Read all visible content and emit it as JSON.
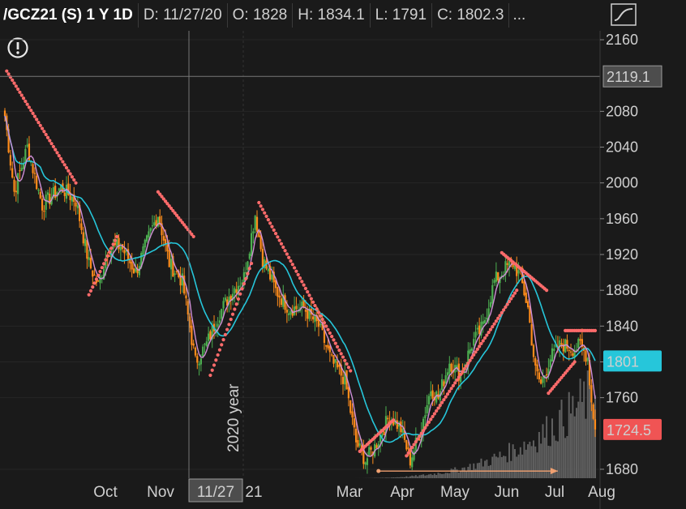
{
  "header": {
    "symbol": "/GCZ21 (S) 1 Y 1D",
    "date": "D: 11/27/20",
    "open": "O: 1828",
    "high": "H: 1834.1",
    "low": "L: 1791",
    "close": "C: 1802.3",
    "more": "..."
  },
  "icons": {
    "style": "chart-style-icon",
    "alert": "exclamation-circle-icon"
  },
  "colors": {
    "background": "#1a1a1a",
    "up": "#4caf50",
    "down": "#ff8c1a",
    "ma_fast": "#d08fd6",
    "ma_slow": "#26c6da",
    "sar": "#ff6b6b",
    "volume": "#606060",
    "crosshair_label": "#4d4d4d"
  },
  "chart_data": {
    "type": "candlestick",
    "y_ticks": [
      "2160",
      "2080",
      "2040",
      "2000",
      "1960",
      "1920",
      "1880",
      "1840",
      "1800",
      "1760",
      "1680"
    ],
    "ylim": [
      1670,
      2170
    ],
    "x_labels": [
      "Oct",
      "Nov",
      "11/27",
      "21",
      "Mar",
      "Apr",
      "May",
      "Jun",
      "Jul",
      "Aug"
    ],
    "crosshair": {
      "x_label": "11/27",
      "y_label": "2119.1",
      "price": 2119.1
    },
    "price_labels": [
      {
        "name": "sma",
        "text": "1801",
        "value": 1801,
        "color": "#26c6da"
      },
      {
        "name": "last",
        "text": "1724.5",
        "value": 1724.5,
        "color": "#f05454"
      }
    ],
    "year_label": "2020 year",
    "price_path_anchors": [
      [
        0,
        2075
      ],
      [
        5,
        1990
      ],
      [
        12,
        2040
      ],
      [
        20,
        1975
      ],
      [
        30,
        1995
      ],
      [
        38,
        1980
      ],
      [
        45,
        1910
      ],
      [
        50,
        1885
      ],
      [
        55,
        1925
      ],
      [
        62,
        1930
      ],
      [
        70,
        1900
      ],
      [
        78,
        1945
      ],
      [
        82,
        1965
      ],
      [
        88,
        1910
      ],
      [
        95,
        1890
      ],
      [
        102,
        1800
      ],
      [
        108,
        1820
      ],
      [
        115,
        1855
      ],
      [
        122,
        1880
      ],
      [
        128,
        1895
      ],
      [
        134,
        1965
      ],
      [
        138,
        1915
      ],
      [
        145,
        1880
      ],
      [
        152,
        1860
      ],
      [
        160,
        1860
      ],
      [
        168,
        1840
      ],
      [
        175,
        1800
      ],
      [
        182,
        1780
      ],
      [
        188,
        1710
      ],
      [
        193,
        1690
      ],
      [
        198,
        1705
      ],
      [
        206,
        1740
      ],
      [
        212,
        1725
      ],
      [
        217,
        1690
      ],
      [
        222,
        1720
      ],
      [
        228,
        1770
      ],
      [
        232,
        1760
      ],
      [
        238,
        1800
      ],
      [
        244,
        1785
      ],
      [
        250,
        1820
      ],
      [
        256,
        1840
      ],
      [
        262,
        1890
      ],
      [
        268,
        1905
      ],
      [
        272,
        1910
      ],
      [
        276,
        1895
      ],
      [
        280,
        1860
      ],
      [
        284,
        1790
      ],
      [
        287,
        1775
      ],
      [
        292,
        1805
      ],
      [
        298,
        1820
      ],
      [
        304,
        1815
      ],
      [
        308,
        1818
      ],
      [
        312,
        1805
      ],
      [
        314,
        1755
      ],
      [
        316,
        1724.5
      ]
    ],
    "sar_segments": [
      {
        "from": [
          1,
          2125
        ],
        "to": [
          38,
          2000
        ]
      },
      {
        "from": [
          45,
          1875
        ],
        "to": [
          60,
          1940
        ]
      },
      {
        "from": [
          82,
          1990
        ],
        "to": [
          101,
          1940
        ]
      },
      {
        "from": [
          110,
          1785
        ],
        "to": [
          132,
          1910
        ]
      },
      {
        "from": [
          136,
          1978
        ],
        "to": [
          185,
          1790
        ]
      },
      {
        "from": [
          190,
          1700
        ],
        "to": [
          208,
          1735
        ]
      },
      {
        "from": [
          215,
          1695
        ],
        "to": [
          274,
          1880
        ]
      },
      {
        "from": [
          266,
          1922
        ],
        "to": [
          290,
          1880
        ]
      },
      {
        "from": [
          291,
          1765
        ],
        "to": [
          305,
          1800
        ]
      },
      {
        "from": [
          300,
          1835
        ],
        "to": [
          316,
          1835
        ]
      }
    ],
    "trendline": {
      "from": [
        200,
        1678
      ],
      "to": [
        296,
        1678
      ],
      "color": "#f0a070"
    }
  }
}
